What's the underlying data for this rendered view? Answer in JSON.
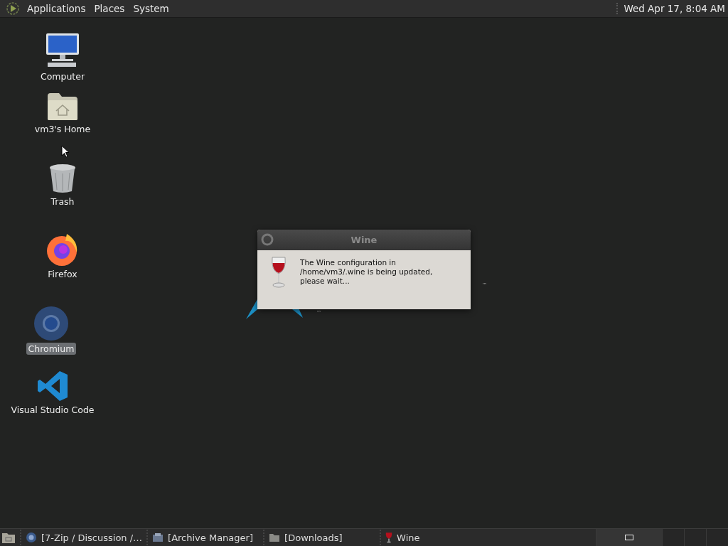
{
  "top_panel": {
    "menus": [
      "Applications",
      "Places",
      "System"
    ],
    "clock": "Wed Apr 17,  8:04 AM"
  },
  "desktop_icons": [
    {
      "kind": "computer",
      "label": "Computer",
      "selected": false
    },
    {
      "kind": "home",
      "label": "vm3's Home",
      "selected": false
    },
    {
      "kind": "trash",
      "label": "Trash",
      "selected": false
    },
    {
      "kind": "firefox",
      "label": "Firefox",
      "selected": false
    },
    {
      "kind": "chromium",
      "label": "Chromium",
      "selected": true
    },
    {
      "kind": "vscode",
      "label": "Visual Studio Code",
      "selected": false
    }
  ],
  "wallpaper_marks": [
    "™",
    "™"
  ],
  "dialog": {
    "title": "Wine",
    "message": "The Wine configuration in /home/vm3/.wine is being updated, please wait..."
  },
  "taskbar": {
    "items": [
      {
        "kind": "chromium",
        "label": "[7-Zip / Discussion /…"
      },
      {
        "kind": "archive",
        "label": "[Archive Manager]"
      },
      {
        "kind": "folder",
        "label": "[Downloads]"
      },
      {
        "kind": "wine",
        "label": "Wine"
      }
    ],
    "workspaces": [
      {
        "selected": true
      },
      {
        "selected": false
      },
      {
        "selected": false
      },
      {
        "selected": false
      }
    ]
  }
}
